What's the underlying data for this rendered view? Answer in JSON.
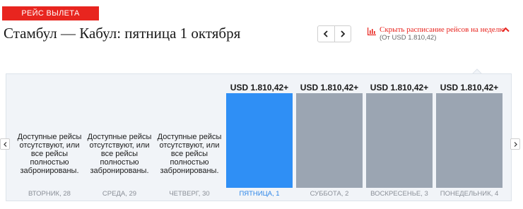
{
  "badge": "Рейс вылета",
  "title": "Стамбул — Кабул: пятница 1 октября",
  "toggle": {
    "label": "Скрыть расписание рейсов на неделю",
    "sub": "(От USD 1.810,42)"
  },
  "colors": {
    "accent": "#e8251f",
    "selected_bar": "#2f8ff5",
    "bar": "#9ba5b2",
    "day_selected": "#2b85e8"
  },
  "calendar": {
    "days": [
      {
        "label": "вторник",
        "date": "28",
        "available": false,
        "message": "Доступные рейсы отсутствуют, или все рейсы полностью забронированы."
      },
      {
        "label": "среда",
        "date": "29",
        "available": false,
        "message": "Доступные рейсы отсутствуют, или все рейсы полностью забронированы."
      },
      {
        "label": "четверг",
        "date": "30",
        "available": false,
        "message": "Доступные рейсы отсутствуют, или все рейсы полностью забронированы."
      },
      {
        "label": "пятница",
        "date": "1",
        "available": true,
        "selected": true,
        "price": "USD 1.810,42+"
      },
      {
        "label": "суббота",
        "date": "2",
        "available": true,
        "price": "USD 1.810,42+"
      },
      {
        "label": "воскресенье",
        "date": "3",
        "available": true,
        "price": "USD 1.810,42+"
      },
      {
        "label": "понедельник",
        "date": "4",
        "available": true,
        "price": "USD 1.810,42+"
      }
    ]
  }
}
